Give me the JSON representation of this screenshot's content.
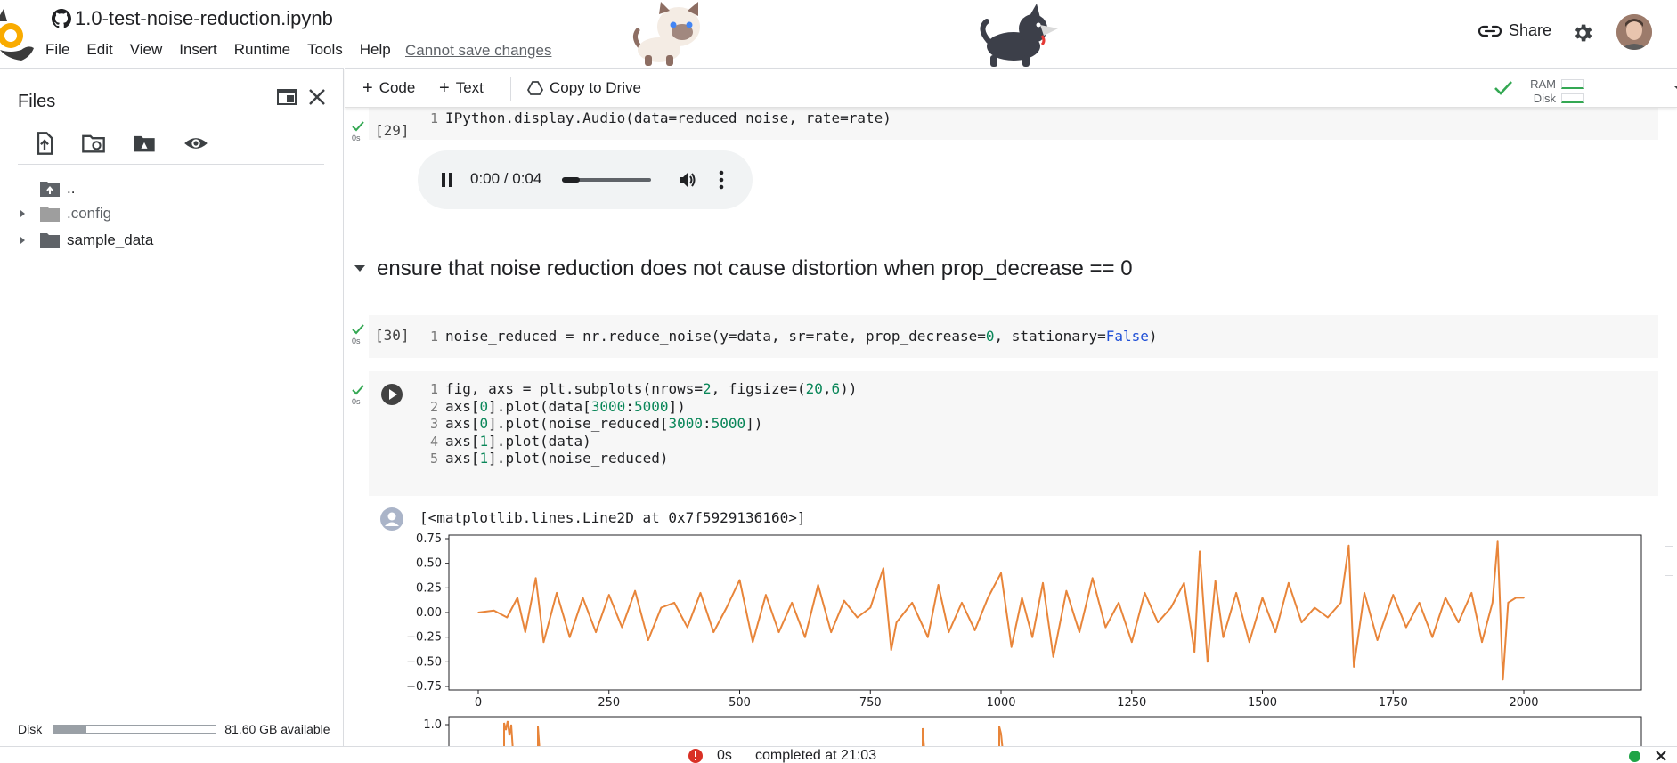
{
  "header": {
    "title": "1.0-test-noise-reduction.ipynb",
    "menu": [
      "File",
      "Edit",
      "View",
      "Insert",
      "Runtime",
      "Tools",
      "Help"
    ],
    "cannot_save": "Cannot save changes",
    "share_label": "Share"
  },
  "sidebar": {
    "title": "Files",
    "tree": [
      {
        "label": "..",
        "icon": "folder-up-icon"
      },
      {
        "label": ".config",
        "icon": "folder-icon"
      },
      {
        "label": "sample_data",
        "icon": "folder-icon"
      }
    ],
    "disk_label": "Disk",
    "disk_available": "81.60 GB available",
    "disk_used_fraction": 0.2
  },
  "toolbar": {
    "code_label": "Code",
    "text_label": "Text",
    "copy_label": "Copy to Drive",
    "ram_label": "RAM",
    "disk_label": "Disk"
  },
  "cells": {
    "c29": {
      "count": "[29]",
      "time": "0s",
      "line_no": "1",
      "code": "IPython.display.Audio(data=reduced_noise, rate=rate)",
      "audio_time": "0:00 / 0:04",
      "played_fraction": 0.2
    },
    "heading": "ensure that noise reduction does not cause distortion when prop_decrease == 0",
    "c30": {
      "count": "[30]",
      "time": "0s",
      "line_no": "1",
      "code_a": "noise_reduced = nr.reduce_noise(y=data, sr=rate, prop_decrease=",
      "code_num": "0",
      "code_b": ", stationary=",
      "code_kw": "False",
      "code_c": ")"
    },
    "c31": {
      "time": "0s",
      "lines": [
        {
          "n": "1",
          "parts": [
            [
              "fig, axs = plt.subplots(nrows=",
              ""
            ],
            [
              "2",
              "num"
            ],
            [
              ", figsize=(",
              ""
            ],
            [
              "20",
              "num"
            ],
            [
              ",",
              ""
            ],
            [
              "6",
              "num"
            ],
            [
              "))",
              ""
            ]
          ]
        },
        {
          "n": "2",
          "parts": [
            [
              "axs[",
              ""
            ],
            [
              "0",
              "num"
            ],
            [
              "].plot(data[",
              ""
            ],
            [
              "3000",
              "num"
            ],
            [
              ":",
              ""
            ],
            [
              "5000",
              "num"
            ],
            [
              "])",
              ""
            ]
          ]
        },
        {
          "n": "3",
          "parts": [
            [
              "axs[",
              ""
            ],
            [
              "0",
              "num"
            ],
            [
              "].plot(noise_reduced[",
              ""
            ],
            [
              "3000",
              "num"
            ],
            [
              ":",
              ""
            ],
            [
              "5000",
              "num"
            ],
            [
              "])",
              ""
            ]
          ]
        },
        {
          "n": "4",
          "parts": [
            [
              "axs[",
              ""
            ],
            [
              "1",
              "num"
            ],
            [
              "].plot(data)",
              ""
            ]
          ]
        },
        {
          "n": "5",
          "parts": [
            [
              "axs[",
              ""
            ],
            [
              "1",
              "num"
            ],
            [
              "].plot(noise_reduced)",
              ""
            ]
          ]
        }
      ],
      "output_text": "[<matplotlib.lines.Line2D at 0x7f5929136160>]"
    }
  },
  "status": {
    "time": "0s",
    "completed": "completed at 21:03"
  },
  "colors": {
    "series_orange": "#e8853a",
    "status_green": "#1ea446",
    "error_red": "#d93025"
  },
  "chart_data": [
    {
      "type": "line",
      "xlim": [
        0,
        2000
      ],
      "ylim": [
        -0.75,
        0.75
      ],
      "x_ticks": [
        "0",
        "250",
        "500",
        "750",
        "1000",
        "1250",
        "1500",
        "1750",
        "2000"
      ],
      "y_ticks": [
        "0.75",
        "0.50",
        "0.25",
        "0.00",
        "−0.25",
        "−0.50",
        "−0.75"
      ],
      "x": [
        0,
        30,
        55,
        75,
        90,
        110,
        125,
        150,
        175,
        200,
        225,
        250,
        275,
        300,
        325,
        350,
        375,
        400,
        425,
        450,
        475,
        500,
        525,
        550,
        575,
        600,
        625,
        650,
        675,
        700,
        725,
        750,
        775,
        790,
        800,
        830,
        860,
        880,
        900,
        925,
        950,
        975,
        1000,
        1020,
        1040,
        1060,
        1080,
        1100,
        1125,
        1150,
        1175,
        1200,
        1225,
        1250,
        1275,
        1300,
        1325,
        1350,
        1370,
        1380,
        1395,
        1410,
        1425,
        1450,
        1475,
        1500,
        1525,
        1550,
        1575,
        1600,
        1625,
        1650,
        1665,
        1675,
        1695,
        1720,
        1750,
        1775,
        1800,
        1825,
        1850,
        1875,
        1900,
        1920,
        1940,
        1950,
        1960,
        1970,
        1985,
        2000
      ],
      "y": [
        0,
        0.02,
        -0.05,
        0.15,
        -0.2,
        0.35,
        -0.3,
        0.2,
        -0.25,
        0.15,
        -0.2,
        0.18,
        -0.15,
        0.22,
        -0.28,
        0.05,
        0.1,
        -0.15,
        0.2,
        -0.2,
        0.05,
        0.33,
        -0.3,
        0.18,
        -0.2,
        0.1,
        -0.25,
        0.28,
        -0.2,
        0.12,
        -0.05,
        0.05,
        0.45,
        -0.38,
        -0.1,
        0.1,
        -0.25,
        0.28,
        -0.2,
        0.1,
        -0.18,
        0.15,
        0.4,
        -0.35,
        0.15,
        -0.25,
        0.3,
        -0.45,
        0.22,
        -0.2,
        0.35,
        -0.15,
        0.1,
        -0.3,
        0.2,
        -0.1,
        0.05,
        0.3,
        -0.4,
        0.62,
        -0.5,
        0.32,
        -0.25,
        0.2,
        -0.3,
        0.15,
        -0.2,
        0.3,
        -0.1,
        0.05,
        -0.05,
        0.1,
        0.68,
        -0.55,
        0.2,
        -0.28,
        0.18,
        -0.15,
        0.1,
        -0.25,
        0.15,
        -0.1,
        0.2,
        -0.3,
        0.1,
        0.72,
        -0.68,
        0.1,
        0.15,
        0.15
      ]
    }
  ]
}
